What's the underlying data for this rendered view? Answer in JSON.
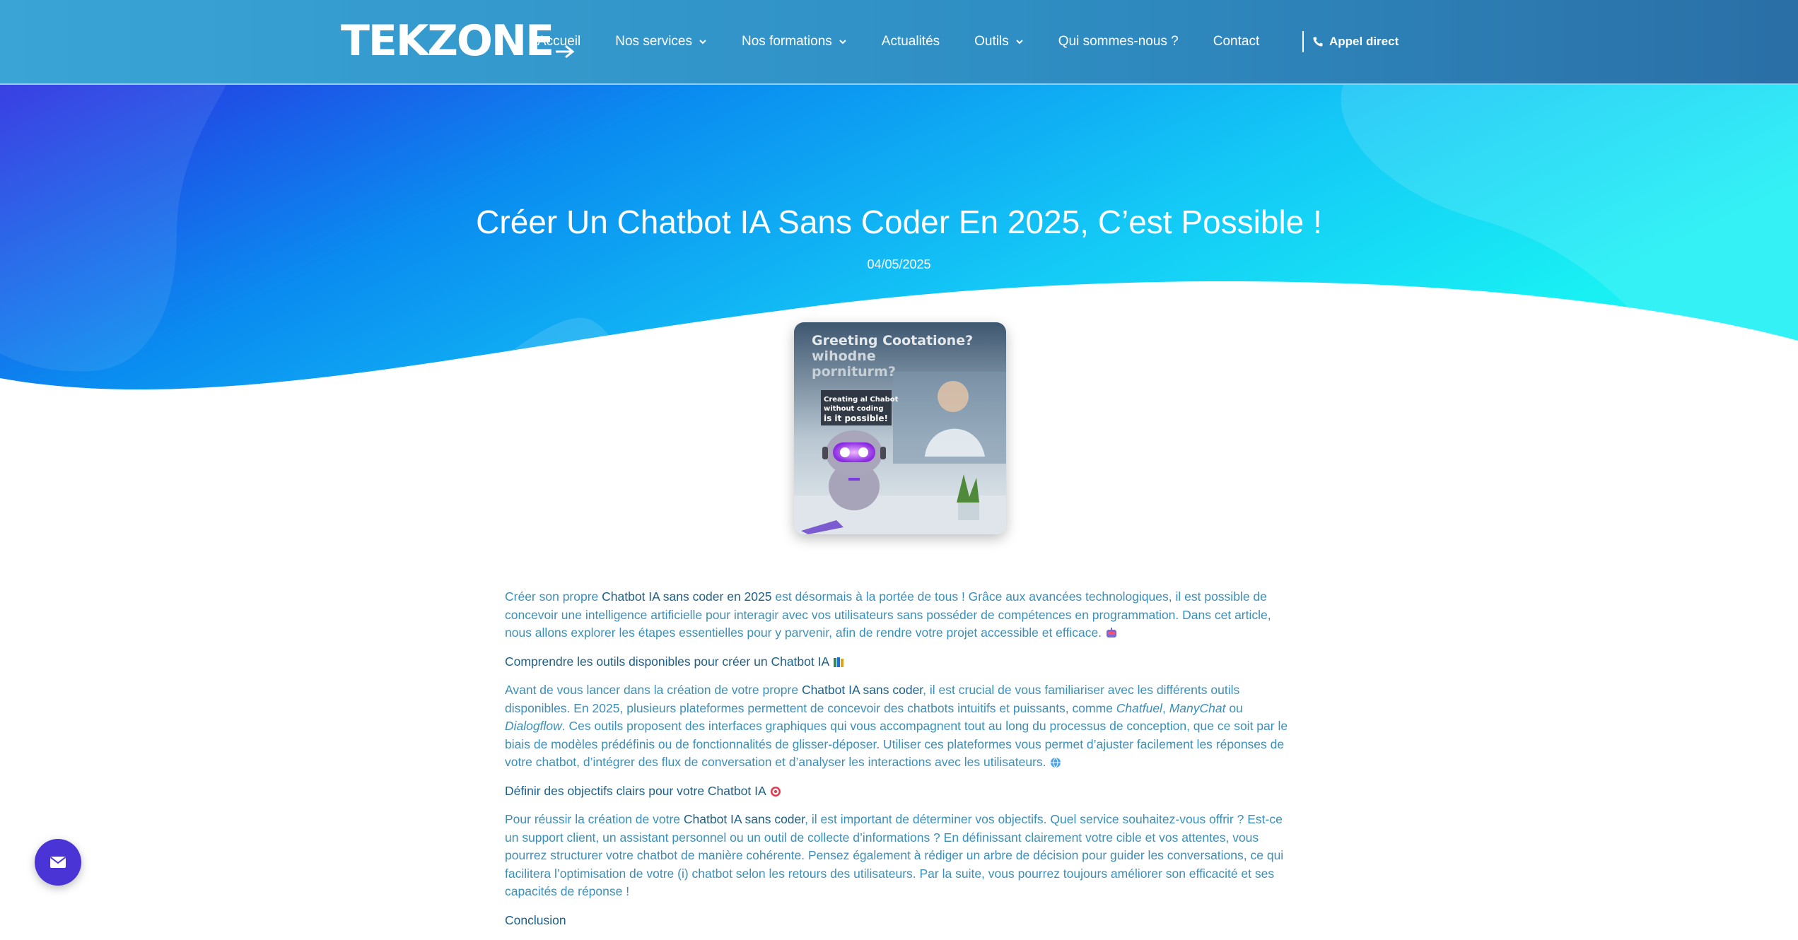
{
  "brand": {
    "logo_text": "TEKZONE"
  },
  "nav": {
    "items": [
      {
        "label": "Accueil",
        "dropdown": false
      },
      {
        "label": "Nos services",
        "dropdown": true
      },
      {
        "label": "Nos formations",
        "dropdown": true
      },
      {
        "label": "Actualités",
        "dropdown": false
      },
      {
        "label": "Outils",
        "dropdown": true
      },
      {
        "label": "Qui sommes-nous ?",
        "dropdown": false
      },
      {
        "label": "Contact",
        "dropdown": false
      }
    ],
    "call_label": "Appel direct",
    "call_icon": "phone-icon"
  },
  "hero": {
    "title": "Créer Un Chatbot IA Sans Coder En 2025, C’est Possible !",
    "date": "04/05/2025"
  },
  "featured_image": {
    "headline_line1": "Greeting Cootatione?",
    "headline_line2": "wihodne",
    "headline_line3": "porniturm?",
    "caption_line1": "Creating al Chabot",
    "caption_line2": "without coding",
    "caption_line3": "is it possible!"
  },
  "article": {
    "intro": {
      "before": "Créer son propre ",
      "strong": "Chatbot IA sans coder en 2025",
      "after": " est désormais à la portée de tous ! Grâce aux avancées technologiques, il est possible de concevoir une intelligence artificielle pour interagir avec vos utilisateurs sans posséder de compétences en programmation. Dans cet article, nous allons explorer les étapes essentielles pour y parvenir, afin de rendre votre projet accessible et efficace."
    },
    "section1_title": "Comprendre les outils disponibles pour créer un Chatbot IA",
    "section1": {
      "before": "Avant de vous lancer dans la création de votre propre ",
      "strong": "Chatbot IA sans coder",
      "mid": ", il est crucial de vous familiariser avec les différents outils disponibles. En 2025, plusieurs plateformes permettent de concevoir des chatbots intuitifs et puissants, comme ",
      "tool1": "Chatfuel",
      "sep1": ", ",
      "tool2": "ManyChat",
      "sep2": " ou ",
      "tool3": "Dialogflow",
      "after": ". Ces outils proposent des interfaces graphiques qui vous accompagnent tout au long du processus de conception, que ce soit par le biais de modèles prédéfinis ou de fonctionnalités de glisser-déposer. Utiliser ces plateformes vous permet d’ajuster facilement les réponses de votre chatbot, d’intégrer des flux de conversation et d’analyser les interactions avec les utilisateurs."
    },
    "section2_title": "Définir des objectifs clairs pour votre Chatbot IA",
    "section2": {
      "before": "Pour réussir la création de votre ",
      "strong": "Chatbot IA sans coder",
      "after": ", il est important de déterminer vos objectifs. Quel service souhaitez-vous offrir ? Est-ce un support client, un assistant personnel ou un outil de collecte d’informations ? En définissant clairement votre cible et vos attentes, vous pourrez structurer votre chatbot de manière cohérente. Pensez également à rédiger un arbre de décision pour guider les conversations, ce qui facilitera l’optimisation de votre (i) chatbot selon les retours des utilisateurs. Par la suite, vous pourrez toujours améliorer son efficacité et ses capacités de réponse !"
    },
    "section3_title": "Conclusion"
  },
  "floating_button": {
    "icon": "envelope-icon"
  },
  "colors": {
    "header_start": "#3aa4d6",
    "header_end": "#2a6fa6",
    "hero_blue": "#2535e0",
    "hero_cyan": "#17e8f5",
    "text": "#3b8fb8",
    "text_strong": "#1d5f86",
    "fab": "#4a34d6"
  }
}
